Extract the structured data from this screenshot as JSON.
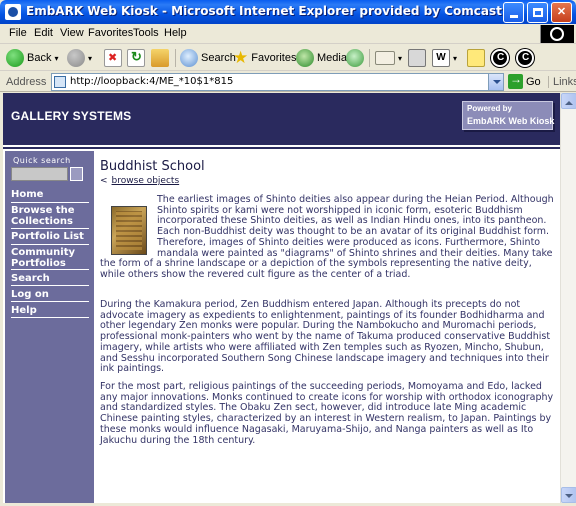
{
  "window": {
    "title": "EmbARK Web Kiosk - Microsoft Internet Explorer provided by Comcast"
  },
  "menu": [
    "File",
    "Edit",
    "View",
    "Favorites",
    "Tools",
    "Help"
  ],
  "toolbar": {
    "back": "Back",
    "search": "Search",
    "favorites": "Favorites",
    "media": "Media"
  },
  "address": {
    "label": "Address",
    "url": "http://loopback:4/ME_*10$1*815",
    "go": "Go",
    "links": "Links"
  },
  "site": {
    "name": "GALLERY SYSTEMS",
    "powered_line1": "Powered by",
    "powered_line2": "EmbARK Web Kiosk"
  },
  "sidebar": {
    "quick_search_label": "Quick search",
    "items": [
      "Home",
      "Browse the Collections",
      "Portfolio List",
      "Community Portfolios",
      "Search",
      "Log on",
      "Help"
    ]
  },
  "content": {
    "title": "Buddhist School",
    "back_prefix": "<",
    "back_link": "browse objects",
    "paragraphs": [
      "The earliest images of Shinto deities also appear during the Heian Period. Although Shinto spirits or kami were not worshipped in iconic form, esoteric Buddhism incorporated these Shinto deities, as well as Indian Hindu ones, into its pantheon. Each non-Buddhist deity was thought to be an avatar of its original Buddhist form. Therefore, images of Shinto deities were produced as icons. Furthermore, Shinto mandala were painted as \"diagrams\" of Shinto shrines and their deities. Many take the form of a shrine landscape or a depiction of the symbols representing the native deity, while others show the revered cult figure as the center of a triad.",
      "During the Kamakura period, Zen Buddhism entered Japan. Although its precepts do not advocate imagery as expedients to enlightenment, paintings of its founder Bodhidharma and other legendary Zen monks were popular. During the Nambokucho and Muromachi periods, professional monk-painters who went by the name of Takuma produced conservative Buddhist imagery, while artists who were affiliated with Zen temples such as Ryozen, Mincho, Shubun, and Sesshu incorporated Southern Song Chinese landscape imagery and techniques into their ink paintings.",
      "For the most part, religious paintings of the succeeding periods, Momoyama and Edo, lacked any major innovations. Monks continued to create icons for worship with orthodox iconography and standardized styles. The Obaku Zen sect, however, did introduce late Ming academic Chinese painting styles, characterized by an interest in Western realism, to Japan. Paintings by these monks would influence Nagasaki, Maruyama-Shijo, and Nanga painters as well as Ito Jakuchu during the 18th century."
    ]
  }
}
